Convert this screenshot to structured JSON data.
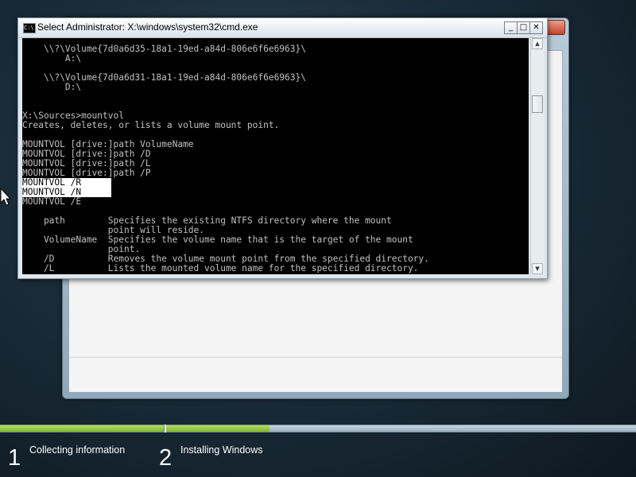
{
  "cmd": {
    "title": "Select Administrator: X:\\windows\\system32\\cmd.exe",
    "icon_text": "C:\\",
    "minimize_glyph": "_",
    "maximize_glyph": "□",
    "close_glyph": "✕",
    "lines": [
      "    \\\\?\\Volume{7d0a6d35-18a1-19ed-a84d-806e6f6e6963}\\",
      "        A:\\",
      "",
      "    \\\\?\\Volume{7d0a6d31-18a1-19ed-a84d-806e6f6e6963}\\",
      "        D:\\",
      "",
      "",
      "X:\\Sources>mountvol",
      "Creates, deletes, or lists a volume mount point.",
      "",
      "MOUNTVOL [drive:]path VolumeName",
      "MOUNTVOL [drive:]path /D",
      "MOUNTVOL [drive:]path /L",
      "MOUNTVOL [drive:]path /P",
      "MOUNTVOL /R",
      "MOUNTVOL /N",
      "MOUNTVOL /E",
      "",
      "    path        Specifies the existing NTFS directory where the mount",
      "                point will reside.",
      "    VolumeName  Specifies the volume name that is the target of the mount",
      "                point.",
      "    /D          Removes the volume mount point from the specified directory.",
      "    /L          Lists the mounted volume name for the specified directory."
    ]
  },
  "steps": [
    {
      "number": "1",
      "label": "Collecting information"
    },
    {
      "number": "2",
      "label": "Installing Windows"
    }
  ],
  "progress": {
    "step1_fraction": 1.0,
    "step2_fraction": 0.22
  },
  "colors": {
    "console_bg": "#000000",
    "console_fg": "#c0c0c0",
    "progress_green": "#8cc63f",
    "desktop_bg": "#1b2d3a"
  }
}
